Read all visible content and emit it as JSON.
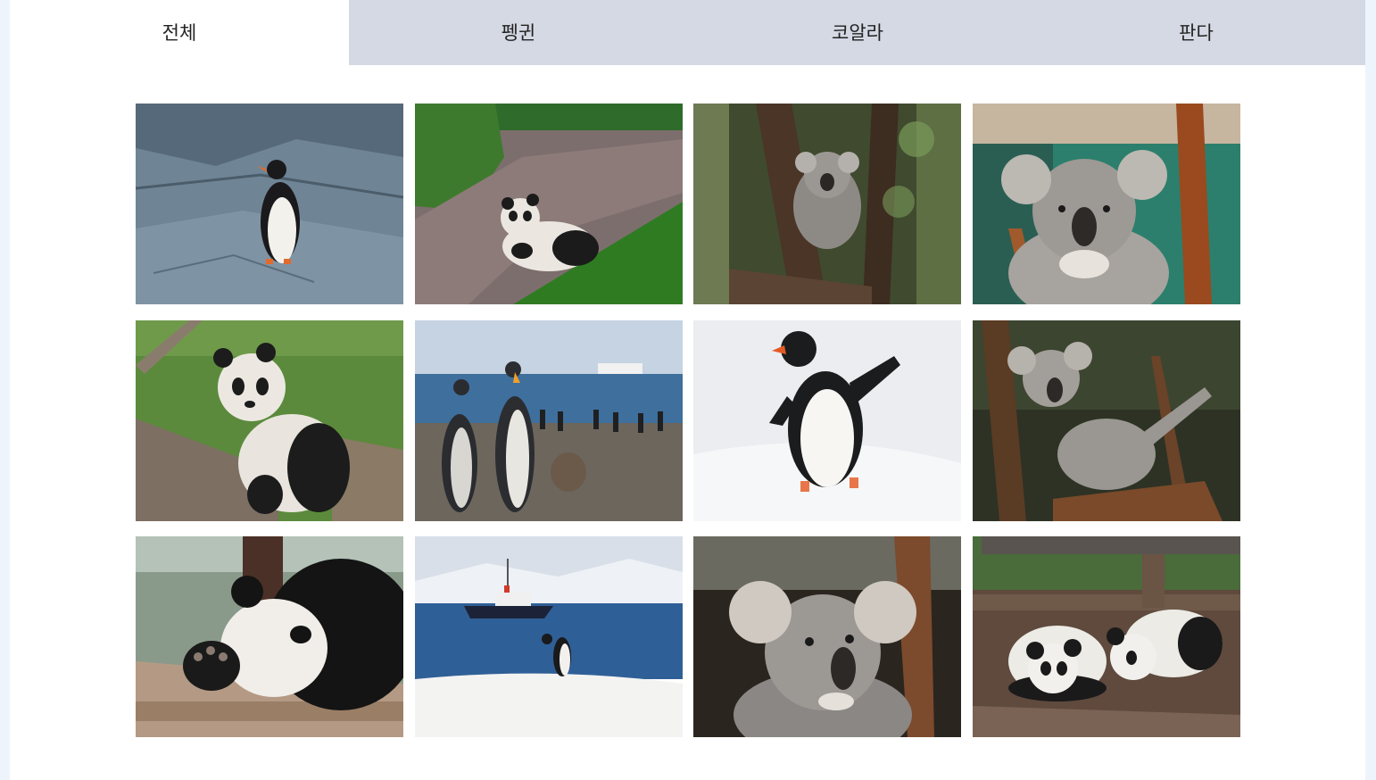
{
  "tabs": [
    {
      "label": "전체",
      "active": true
    },
    {
      "label": "펭귄",
      "active": false
    },
    {
      "label": "코알라",
      "active": false
    },
    {
      "label": "판다",
      "active": false
    }
  ],
  "gallery": [
    {
      "animal": "penguin",
      "scene": "penguin-on-rocks"
    },
    {
      "animal": "panda",
      "scene": "panda-lying-by-stone-wall"
    },
    {
      "animal": "koala",
      "scene": "koala-sleeping-in-tree"
    },
    {
      "animal": "koala",
      "scene": "koala-closeup-by-tree"
    },
    {
      "animal": "panda",
      "scene": "panda-sitting-on-logs"
    },
    {
      "animal": "penguin",
      "scene": "king-penguins-on-beach"
    },
    {
      "animal": "penguin",
      "scene": "penguin-walking-in-snow"
    },
    {
      "animal": "koala",
      "scene": "koala-stretching-on-branch"
    },
    {
      "animal": "panda",
      "scene": "panda-resting-on-logs"
    },
    {
      "animal": "penguin",
      "scene": "penguin-on-ice-with-ship"
    },
    {
      "animal": "koala",
      "scene": "koala-portrait"
    },
    {
      "animal": "panda",
      "scene": "two-panda-cubs"
    }
  ],
  "colors": {
    "active_tab": "#ffffff",
    "inactive_tab": "#d4d9e4",
    "page_background": "#eef4fc"
  }
}
